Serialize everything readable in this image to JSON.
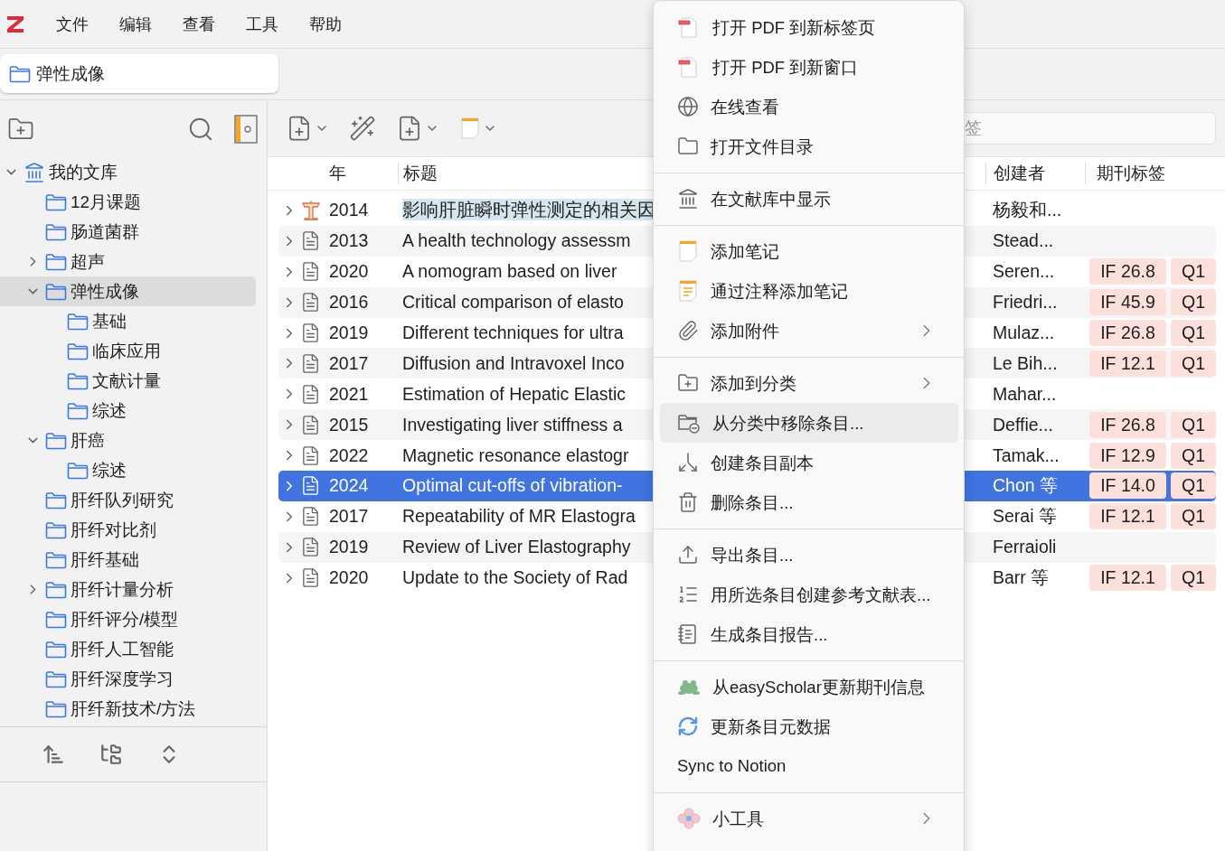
{
  "menubar": {
    "items": [
      "文件",
      "编辑",
      "查看",
      "工具",
      "帮助"
    ]
  },
  "tabs": [
    {
      "label": "弹性成像",
      "selected": true
    }
  ],
  "tree": [
    {
      "label": "我的文库",
      "kind": "library",
      "expanded": true,
      "selected": false,
      "children": [
        {
          "label": "12月课题",
          "kind": "folder",
          "selected": false
        },
        {
          "label": "肠道菌群",
          "kind": "folder",
          "selected": false
        },
        {
          "label": "超声",
          "kind": "folder",
          "expanded": false,
          "selected": false
        },
        {
          "label": "弹性成像",
          "kind": "folder",
          "expanded": true,
          "selected": true,
          "children": [
            {
              "label": "基础",
              "kind": "folder",
              "selected": false
            },
            {
              "label": "临床应用",
              "kind": "folder",
              "selected": false
            },
            {
              "label": "文献计量",
              "kind": "folder",
              "selected": false
            },
            {
              "label": "综述",
              "kind": "folder",
              "selected": false
            }
          ]
        },
        {
          "label": "肝癌",
          "kind": "folder",
          "expanded": true,
          "selected": false,
          "children": [
            {
              "label": "综述",
              "kind": "folder",
              "selected": false
            }
          ]
        },
        {
          "label": "肝纤队列研究",
          "kind": "folder",
          "selected": false
        },
        {
          "label": "肝纤对比剂",
          "kind": "folder",
          "selected": false
        },
        {
          "label": "肝纤基础",
          "kind": "folder",
          "selected": false
        },
        {
          "label": "肝纤计量分析",
          "kind": "folder",
          "expanded": false,
          "selected": false
        },
        {
          "label": "肝纤评分/模型",
          "kind": "folder",
          "selected": false
        },
        {
          "label": "肝纤人工智能",
          "kind": "folder",
          "selected": false
        },
        {
          "label": "肝纤深度学习",
          "kind": "folder",
          "selected": false
        },
        {
          "label": "肝纤新技术/方法",
          "kind": "folder",
          "selected": false
        }
      ]
    }
  ],
  "search": {
    "placeholder": "签"
  },
  "table": {
    "columns": [
      "年",
      "标题",
      "创建者",
      "期刊标签"
    ],
    "rows": [
      {
        "kind": "web",
        "year": "2014",
        "title": "影响肝脏瞬时弹性测定的相关因",
        "creator": "杨毅和...",
        "tags": [],
        "selected": false,
        "highlighted": true
      },
      {
        "kind": "article",
        "year": "2013",
        "title": "A health technology assessm",
        "creator": "Stead...",
        "tags": [],
        "selected": false,
        "highlighted": false
      },
      {
        "kind": "article",
        "year": "2020",
        "title": "A nomogram based on liver",
        "creator": "Seren...",
        "tags": [
          "IF 26.8",
          "Q1"
        ],
        "selected": false,
        "highlighted": false
      },
      {
        "kind": "article",
        "year": "2016",
        "title": "Critical comparison of elasto",
        "creator": "Friedri...",
        "tags": [
          "IF 45.9",
          "Q1"
        ],
        "selected": false,
        "highlighted": false
      },
      {
        "kind": "article",
        "year": "2019",
        "title": "Different techniques for ultra",
        "creator": "Mulaz...",
        "tags": [
          "IF 26.8",
          "Q1"
        ],
        "selected": false,
        "highlighted": false
      },
      {
        "kind": "article",
        "year": "2017",
        "title": "Diffusion and Intravoxel Inco",
        "creator": "Le Bih...",
        "tags": [
          "IF 12.1",
          "Q1"
        ],
        "selected": false,
        "highlighted": false
      },
      {
        "kind": "article",
        "year": "2021",
        "title": "Estimation of Hepatic Elastic",
        "creator": "Mahar...",
        "tags": [],
        "selected": false,
        "highlighted": false
      },
      {
        "kind": "article",
        "year": "2015",
        "title": "Investigating liver stiffness a",
        "creator": "Deffie...",
        "tags": [
          "IF 26.8",
          "Q1"
        ],
        "selected": false,
        "highlighted": false
      },
      {
        "kind": "article",
        "year": "2022",
        "title": "Magnetic resonance elastogr",
        "creator": "Tamak...",
        "tags": [
          "IF 12.9",
          "Q1"
        ],
        "selected": false,
        "highlighted": false
      },
      {
        "kind": "article",
        "year": "2024",
        "title": "Optimal cut-offs of vibration-",
        "creator": "Chon 等",
        "tags": [
          "IF 14.0",
          "Q1"
        ],
        "selected": true,
        "highlighted": false
      },
      {
        "kind": "article",
        "year": "2017",
        "title": "Repeatability of MR Elastogra",
        "creator": "Serai 等",
        "tags": [
          "IF 12.1",
          "Q1"
        ],
        "selected": false,
        "highlighted": false
      },
      {
        "kind": "article",
        "year": "2019",
        "title": "Review of Liver Elastography",
        "creator": "Ferraioli",
        "tags": [],
        "selected": false,
        "highlighted": false
      },
      {
        "kind": "article",
        "year": "2020",
        "title": "Update to the Society of Rad",
        "creator": "Barr 等",
        "tags": [
          "IF 12.1",
          "Q1"
        ],
        "selected": false,
        "highlighted": false
      }
    ]
  },
  "context_menu": {
    "sections": [
      {
        "items": [
          {
            "kind": "pdf",
            "label": "打开 PDF 到新标签页",
            "submenu": false,
            "hovered": false
          },
          {
            "kind": "pdf",
            "label": "打开 PDF 到新窗口",
            "submenu": false,
            "hovered": false
          },
          {
            "kind": "globe",
            "label": "在线查看",
            "submenu": false,
            "hovered": false
          },
          {
            "kind": "folder",
            "label": "打开文件目录",
            "submenu": false,
            "hovered": false
          }
        ]
      },
      {
        "items": [
          {
            "kind": "library",
            "label": "在文献库中显示",
            "submenu": false,
            "hovered": false
          }
        ]
      },
      {
        "items": [
          {
            "kind": "note",
            "label": "添加笔记",
            "submenu": false,
            "hovered": false
          },
          {
            "kind": "annotation-note",
            "label": "通过注释添加笔记",
            "submenu": false,
            "hovered": false
          },
          {
            "kind": "attachment",
            "label": "添加附件",
            "submenu": true,
            "hovered": false
          }
        ]
      },
      {
        "items": [
          {
            "kind": "add-collection",
            "label": "添加到分类",
            "submenu": true,
            "hovered": false
          },
          {
            "kind": "remove-collection",
            "label": "从分类中移除条目...",
            "submenu": false,
            "hovered": true
          },
          {
            "kind": "duplicate",
            "label": "创建条目副本",
            "submenu": false,
            "hovered": false
          },
          {
            "kind": "trash",
            "label": "删除条目...",
            "submenu": false,
            "hovered": false
          }
        ]
      },
      {
        "items": [
          {
            "kind": "export",
            "label": "导出条目...",
            "submenu": false,
            "hovered": false
          },
          {
            "kind": "bibliography",
            "label": "用所选条目创建参考文献表...",
            "submenu": false,
            "hovered": false
          },
          {
            "kind": "report",
            "label": "生成条目报告...",
            "submenu": false,
            "hovered": false
          }
        ]
      },
      {
        "items": [
          {
            "kind": "frog",
            "label": "从easyScholar更新期刊信息",
            "submenu": false,
            "hovered": false
          },
          {
            "kind": "refresh",
            "label": "更新条目元数据",
            "submenu": false,
            "hovered": false
          },
          {
            "kind": "plain",
            "label": "Sync to Notion",
            "submenu": false,
            "hovered": false
          }
        ]
      },
      {
        "items": [
          {
            "kind": "gadget",
            "label": "小工具",
            "submenu": true,
            "hovered": false
          }
        ]
      }
    ]
  }
}
